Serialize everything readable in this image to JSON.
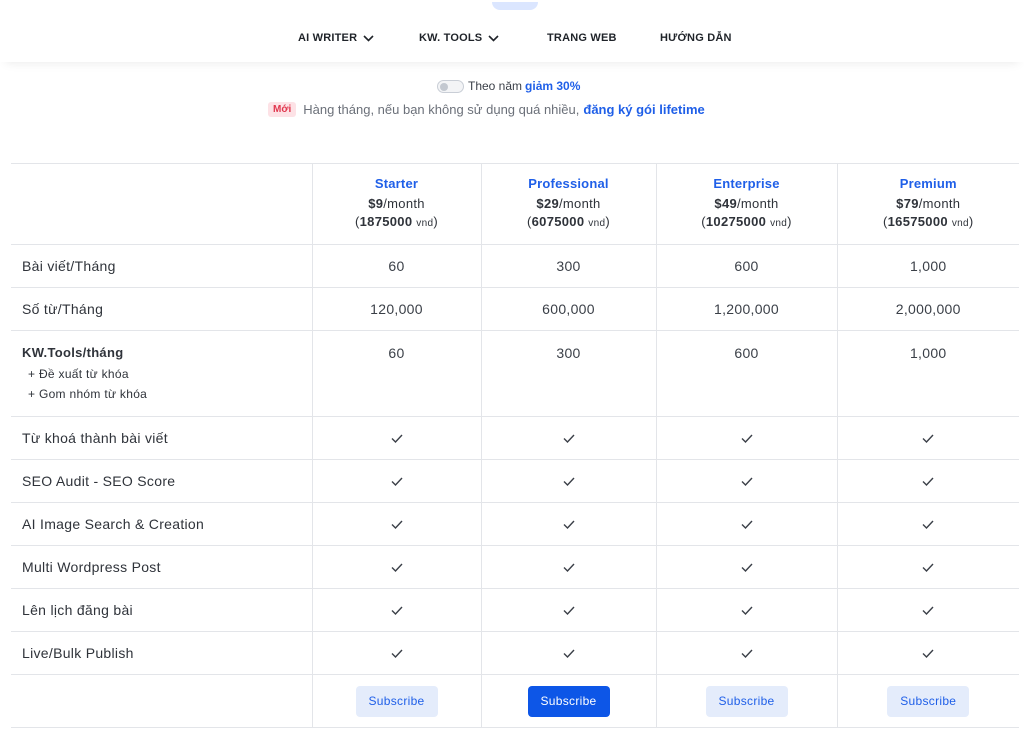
{
  "header": {
    "nav": [
      {
        "label": "AI WRITER",
        "has_dropdown": true
      },
      {
        "label": "KW. TOOLS",
        "has_dropdown": true
      },
      {
        "label": "TRANG WEB",
        "has_dropdown": false
      },
      {
        "label": "HƯỚNG DẪN",
        "has_dropdown": false
      }
    ]
  },
  "billing": {
    "toggle_label": "Theo năm",
    "discount": "giảm 30%",
    "toggle_on": false
  },
  "notice": {
    "badge": "Mới",
    "text": "Hàng tháng, nếu bạn không sử dụng quá nhiều,",
    "link": "đăng ký gói lifetime"
  },
  "plans": [
    {
      "name": "Starter",
      "price": "$9",
      "per": "/month",
      "vnd": "1875000",
      "vnd_unit": "vnd",
      "cta": "Subscribe",
      "highlight": false
    },
    {
      "name": "Professional",
      "price": "$29",
      "per": "/month",
      "vnd": "6075000",
      "vnd_unit": "vnd",
      "cta": "Subscribe",
      "highlight": true
    },
    {
      "name": "Enterprise",
      "price": "$49",
      "per": "/month",
      "vnd": "10275000",
      "vnd_unit": "vnd",
      "cta": "Subscribe",
      "highlight": false
    },
    {
      "name": "Premium",
      "price": "$79",
      "per": "/month",
      "vnd": "16575000",
      "vnd_unit": "vnd",
      "cta": "Subscribe",
      "highlight": false
    }
  ],
  "rows": {
    "posts": {
      "label": "Bài viết/Tháng",
      "values": [
        "60",
        "300",
        "600",
        "1,000"
      ]
    },
    "words": {
      "label": "Số từ/Tháng",
      "values": [
        "120,000",
        "600,000",
        "1,200,000",
        "2,000,000"
      ]
    },
    "kw": {
      "label": "KW.Tools/tháng",
      "sub1": "+ Đề xuất từ khóa",
      "sub2": "+ Gom nhóm từ khóa",
      "values": [
        "60",
        "300",
        "600",
        "1,000"
      ]
    },
    "features": [
      "Từ khoá thành bài viết",
      "SEO Audit - SEO Score",
      "AI Image Search & Creation",
      "Multi Wordpress Post",
      "Lên lịch đăng bài",
      "Live/Bulk Publish"
    ]
  },
  "colors": {
    "accent": "#1f5fe8",
    "primary_button": "#0d56e7",
    "light_button": "#e4ecfb",
    "new_badge": "#fde2e6"
  }
}
